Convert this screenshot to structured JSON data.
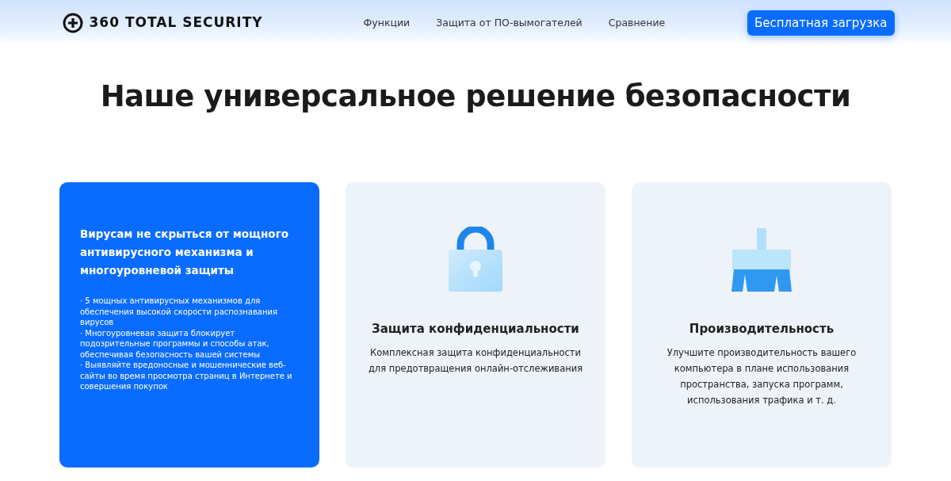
{
  "header": {
    "logo_text": "360 TOTAL SECURITY",
    "nav": [
      "Функции",
      "Защита от ПО-вымогателей",
      "Сравнение"
    ],
    "download_button": "Бесплатная загрузка"
  },
  "heading": "Наше универсальное решение безопасности",
  "cards": [
    {
      "kind": "highlight",
      "title": "Вирусам не скрыться от мощного антивирусного механизма и многоуровневой защиты",
      "points": [
        "· 5 мощных антивирусных механизмов для обеспечения высокой скорости распознавания вирусов",
        "· Многоуровневая защита блокирует подозрительные программы и способы атак, обеспечивая безопасность вашей системы",
        "· Выявляйте вредоносные и мошеннические веб-сайты во время просмотра страниц в Интернете и совершения покупок"
      ]
    },
    {
      "kind": "privacy",
      "title": "Защита конфиденциальности",
      "description": "Комплексная защита конфиденциальности для предотвращения онлайн-отслеживания"
    },
    {
      "kind": "performance",
      "title": "Производительность",
      "description": "Улучшите производительность вашего компьютера в плане использования пространства, запуска программ, использования трафика и т. д."
    }
  ]
}
